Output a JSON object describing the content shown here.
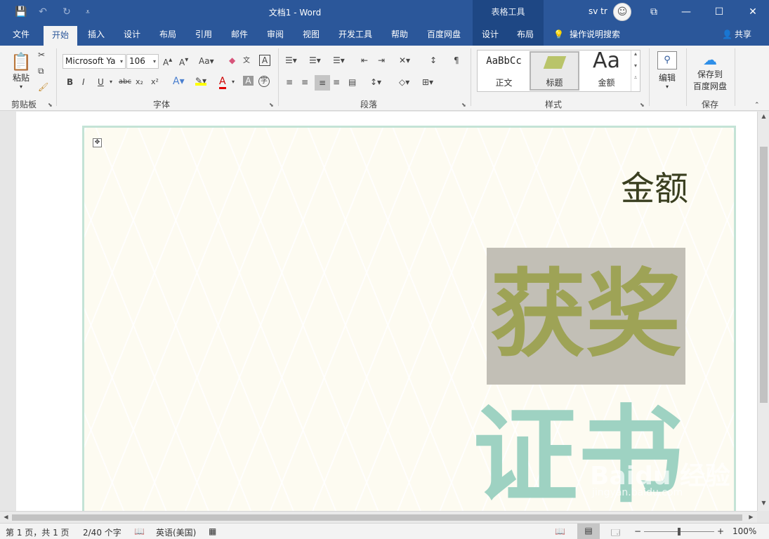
{
  "titlebar": {
    "doc_title": "文档1  -  Word",
    "table_tools": "表格工具",
    "user_name": "sv tr",
    "save_icon": "💾",
    "undo_icon": "↶",
    "redo_icon": "↻",
    "customize_icon": "⩡",
    "ribbon_display_icon": "⧉",
    "minimize_icon": "—",
    "maximize_icon": "☐",
    "close_icon": "✕"
  },
  "tabs": [
    "文件",
    "开始",
    "插入",
    "设计",
    "布局",
    "引用",
    "邮件",
    "审阅",
    "视图",
    "开发工具",
    "帮助",
    "百度网盘",
    "设计",
    "布局"
  ],
  "tell_me": "操作说明搜索",
  "share": "共享",
  "ribbon": {
    "clipboard": {
      "paste": "粘贴",
      "label": "剪贴板"
    },
    "font": {
      "font_name": "Microsoft Ya",
      "font_size": "106",
      "label": "字体",
      "buttons": [
        "B",
        "I",
        "U",
        "abc",
        "x₂",
        "x²"
      ]
    },
    "paragraph": {
      "label": "段落"
    },
    "styles": {
      "label": "样式",
      "items": [
        {
          "preview": "AaBbCc",
          "name": "正文"
        },
        {
          "preview": "",
          "name": "标题"
        },
        {
          "preview": "Aa",
          "name": "金额"
        }
      ]
    },
    "editing": {
      "name": "编辑"
    },
    "save": {
      "line1": "保存到",
      "line2": "百度网盘",
      "label": "保存"
    }
  },
  "document": {
    "amount": "金额",
    "title_line1": "获奖",
    "title_line2": "证书",
    "watermark": "Baidu 经验",
    "watermark_url": "jingyan.baidu.com"
  },
  "status": {
    "page": "第 1 页，共 1 页",
    "words": "2/40 个字",
    "language": "英语(美国)",
    "zoom": "100%"
  }
}
